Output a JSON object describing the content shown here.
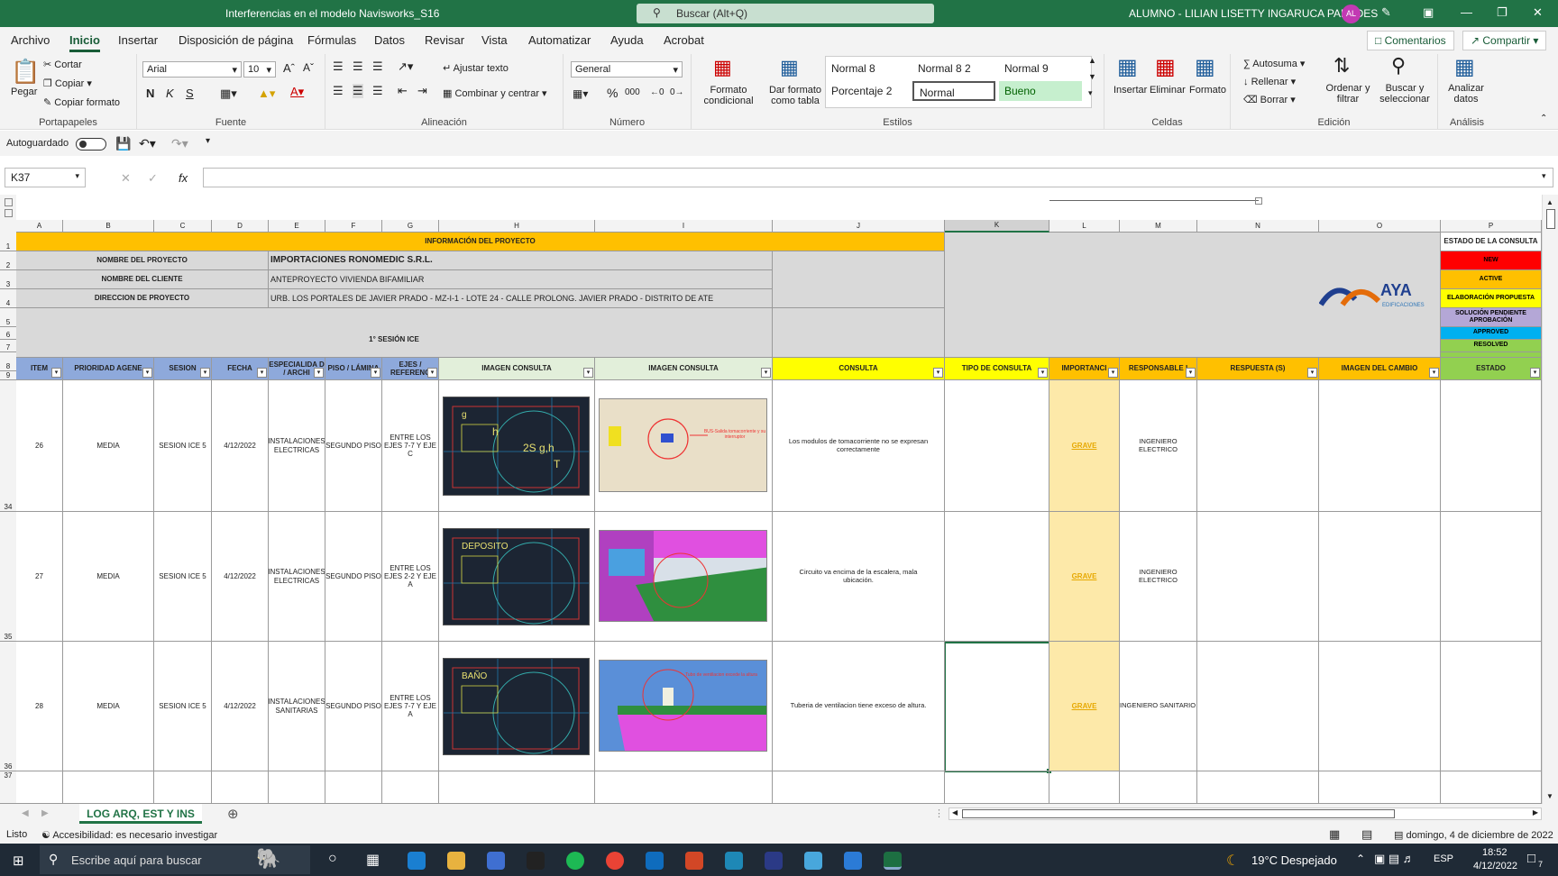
{
  "app": {
    "title": "Interferencias en el modelo Navisworks_S16",
    "search_placeholder": "Buscar (Alt+Q)",
    "user": "ALUMNO - LILIAN LISETTY INGARUCA PAREDES",
    "user_initials": "AL"
  },
  "ribbon_tabs": [
    "Archivo",
    "Inicio",
    "Insertar",
    "Disposición de página",
    "Fórmulas",
    "Datos",
    "Revisar",
    "Vista",
    "Automatizar",
    "Ayuda",
    "Acrobat"
  ],
  "ribbon_right": {
    "comments": "Comentarios",
    "share": "Compartir"
  },
  "clipboard": {
    "paste": "Pegar",
    "cut": "Cortar",
    "copy": "Copiar",
    "format_painter": "Copiar formato",
    "label": "Portapapeles"
  },
  "font": {
    "name": "Arial",
    "size": "10",
    "label": "Fuente",
    "bold": "N",
    "italic": "K",
    "underline": "S"
  },
  "alignment": {
    "wrap": "Ajustar texto",
    "merge": "Combinar y centrar",
    "label": "Alineación"
  },
  "number": {
    "format": "General",
    "label": "Número",
    "percent": "%",
    "thousands": "000"
  },
  "styles": {
    "cond": "Formato condicional",
    "table": "Dar formato como tabla",
    "cells": [
      "Normal 8",
      "Normal 8 2",
      "Normal 9",
      "Porcentaje 2",
      "Normal",
      "Bueno"
    ],
    "label": "Estilos"
  },
  "cells_grp": {
    "insert": "Insertar",
    "delete": "Eliminar",
    "format": "Formato",
    "label": "Celdas"
  },
  "editing": {
    "autosum": "Autosuma",
    "fill": "Rellenar",
    "clear": "Borrar",
    "sort": "Ordenar y filtrar",
    "find": "Buscar y seleccionar",
    "label": "Edición"
  },
  "analysis": {
    "analyze": "Analizar datos",
    "label": "Análisis"
  },
  "qat": {
    "autosave": "Autoguardado"
  },
  "formula": {
    "namebox": "K37",
    "fx": "fx"
  },
  "columns": [
    "A",
    "B",
    "C",
    "D",
    "E",
    "F",
    "G",
    "H",
    "I",
    "J",
    "K",
    "L",
    "M",
    "N",
    "O",
    "P"
  ],
  "sheet": {
    "info_title": "INFORMACIÓN DEL PROYECTO",
    "project_label": "NOMBRE DEL PROYECTO",
    "project_value": "IMPORTACIONES RONOMEDIC S.R.L.",
    "client_label": "NOMBRE DEL CLIENTE",
    "client_value": "ANTEPROYECTO VIVIENDA BIFAMILIAR",
    "address_label": "DIRECCION DE PROYECTO",
    "address_value": "URB. LOS PORTALES DE JAVIER PRADO - MZ-I-1 - LOTE 24 - CALLE PROLONG. JAVIER PRADO - DISTRITO DE ATE",
    "session": "1° SESIÓN ICE",
    "logo_text": "AYA",
    "logo_sub": "EDIFICACIONES",
    "status_title": "ESTADO DE LA CONSULTA",
    "statuses": [
      {
        "label": "NEW",
        "color": "#ff0000",
        "text": "#000000"
      },
      {
        "label": "ACTIVE",
        "color": "#ffc000",
        "text": "#000000"
      },
      {
        "label": "ELABORACIÓN PROPUESTA",
        "color": "#ffff00",
        "text": "#000000"
      },
      {
        "label": "SOLUCIÓN PENDIENTE APROBACIÓN",
        "color": "#b4a7d6",
        "text": "#000000"
      },
      {
        "label": "APPROVED",
        "color": "#00b0f0",
        "text": "#000000"
      },
      {
        "label": "RESOLVED",
        "color": "#92d050",
        "text": "#000000"
      }
    ],
    "headers": [
      "ITEM",
      "PRIORIDAD AGENE",
      "SESION",
      "FECHA",
      "ESPECIALIDA D / ARCHI",
      "PISO / LÁMINA",
      "EJES / REFERENC",
      "IMAGEN CONSULTA",
      "IMAGEN CONSULTA",
      "CONSULTA",
      "TIPO DE CONSULTA",
      "IMPORTANCI",
      "RESPONSABLE I",
      "RESPUESTA (S)",
      "IMAGEN DEL CAMBIO",
      "ESTADO"
    ],
    "rows": [
      {
        "item": "26",
        "priority": "MEDIA",
        "session": "SESION ICE 5",
        "date": "4/12/2022",
        "specialty": "INSTALACIONES ELECTRICAS",
        "floor": "SEGUNDO PISO",
        "axes": "ENTRE LOS EJES 7-7 Y EJE C",
        "query": "Los modulos de tomacorriente no se expresan correctamente",
        "importance": "GRAVE",
        "responsible": "INGENIERO ELECTRICO",
        "img1_labels": [
          "g",
          "h",
          "2S g,h",
          "T"
        ],
        "img2_note": "BUS-Salida tomacorriente y su interruptor"
      },
      {
        "item": "27",
        "priority": "MEDIA",
        "session": "SESION ICE 5",
        "date": "4/12/2022",
        "specialty": "INSTALACIONES ELECTRICAS",
        "floor": "SEGUNDO PISO",
        "axes": "ENTRE LOS EJES 2-2 Y EJE A",
        "query": "Circuito va encima de la escalera, mala ubicación.",
        "importance": "GRAVE",
        "responsible": "INGENIERO ELECTRICO",
        "img1_labels": [
          "DEPOSITO"
        ],
        "img2_note": ""
      },
      {
        "item": "28",
        "priority": "MEDIA",
        "session": "SESION ICE 5",
        "date": "4/12/2022",
        "specialty": "INSTALACIONES SANITARIAS",
        "floor": "SEGUNDO PISO",
        "axes": "ENTRE LOS EJES 7-7 Y EJE A",
        "query": "Tuberia de ventilacion tiene exceso de altura.",
        "importance": "GRAVE",
        "responsible": "INGENIERO SANITARIO",
        "img1_labels": [
          "BAÑO"
        ],
        "img2_note": "Tubo de ventilacion excede la altura"
      }
    ],
    "row_numbers": [
      "1",
      "2",
      "3",
      "4",
      "5",
      "6",
      "7",
      "8",
      "9",
      "34",
      "35",
      "36",
      "37"
    ]
  },
  "sheet_tab": "LOG ARQ, EST Y INS",
  "status": {
    "ready": "Listo",
    "accessibility": "Accesibilidad: es necesario investigar",
    "date_long": "domingo, 4 de diciembre de 2022"
  },
  "taskbar": {
    "search": "Escribe aquí para buscar",
    "weather": "19°C  Despejado",
    "lang": "ESP",
    "time": "18:52",
    "date": "4/12/2022",
    "notif": "7"
  }
}
